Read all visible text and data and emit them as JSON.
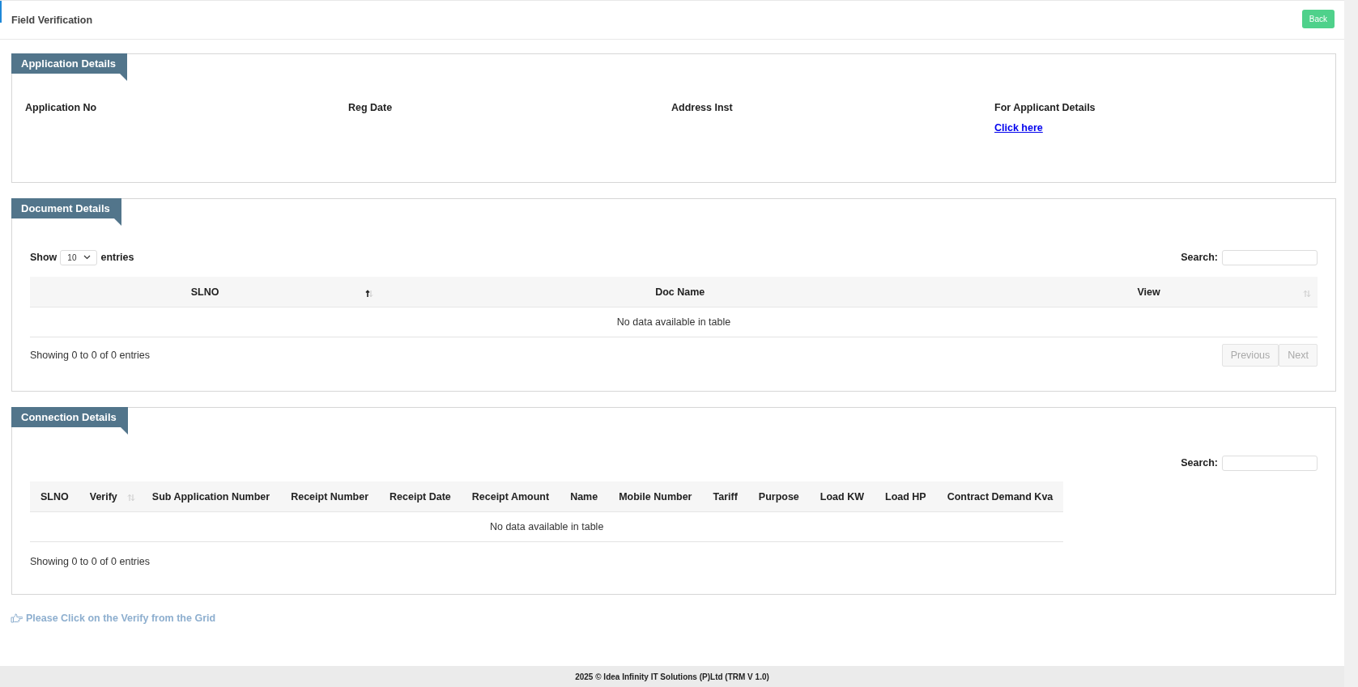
{
  "header": {
    "title": "Field Verification",
    "back_button": "Back"
  },
  "application_details": {
    "title": "Application Details",
    "fields": [
      {
        "label": "Application No"
      },
      {
        "label": "Reg Date"
      },
      {
        "label": "Address Inst"
      },
      {
        "label": "For Applicant Details",
        "link": "Click here"
      }
    ]
  },
  "document_details": {
    "title": "Document Details",
    "length_menu": {
      "show": "Show",
      "value": "10",
      "entries": "entries"
    },
    "search_label": "Search:",
    "table": {
      "columns": [
        {
          "label": "SLNO",
          "sortable": true,
          "sorted": true
        },
        {
          "label": "Doc Name",
          "sortable": false
        },
        {
          "label": "View",
          "sortable": true,
          "sorted": false
        }
      ],
      "empty_message": "No data available in table"
    },
    "info": "Showing 0 to 0 of 0 entries",
    "pagination": [
      {
        "label": "Previous",
        "disabled": true
      },
      {
        "label": "Next",
        "disabled": true
      }
    ]
  },
  "connection_details": {
    "title": "Connection Details",
    "search_label": "Search:",
    "table": {
      "columns": [
        {
          "label": "SLNO",
          "sortable": false
        },
        {
          "label": "Verify",
          "sortable": true,
          "sorted": false
        },
        {
          "label": "Sub Application Number",
          "sortable": false
        },
        {
          "label": "Receipt Number",
          "sortable": false
        },
        {
          "label": "Receipt Date",
          "sortable": false
        },
        {
          "label": "Receipt Amount",
          "sortable": false
        },
        {
          "label": "Name",
          "sortable": false
        },
        {
          "label": "Mobile Number",
          "sortable": false
        },
        {
          "label": "Tariff",
          "sortable": false
        },
        {
          "label": "Purpose",
          "sortable": false
        },
        {
          "label": "Load KW",
          "sortable": false
        },
        {
          "label": "Load HP",
          "sortable": false
        },
        {
          "label": "Contract Demand Kva",
          "sortable": false
        }
      ],
      "empty_message": "No data available in table"
    },
    "info": "Showing 0 to 0 of 0 entries"
  },
  "hint": "Please Click on the Verify from the Grid",
  "footer": "2025 © Idea Infinity IT Solutions (P)Ltd (TRM V 1.0)"
}
